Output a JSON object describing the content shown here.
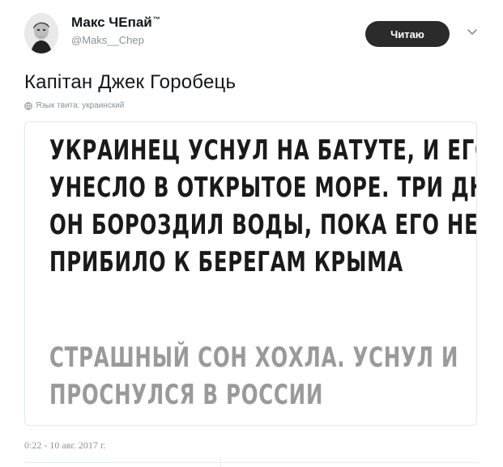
{
  "user": {
    "display_name": "Макс ЧЕпай",
    "name_mark": "™",
    "handle": "@Maks__Chep"
  },
  "follow_button_label": "Читаю",
  "tweet": {
    "text": "Капітан Джек Горобець",
    "language_note": "Язык твита: украинский",
    "timestamp": "0:22 - 10 авг. 2017 г."
  },
  "meme": {
    "main_lines": [
      "УКРАИНЕЦ УСНУЛ НА БАТУТЕ, И ЕГО",
      "УНЕСЛО В ОТКРЫТОЕ МОРЕ. ТРИ ДНЯ",
      "ОН БОРОЗДИЛ ВОДЫ, ПОКА ЕГО НЕ",
      "ПРИБИЛО К БЕРЕГАМ КРЫМА"
    ],
    "sub_lines": [
      "СТРАШНЫЙ СОН ХОХЛА. УСНУЛ И",
      "ПРОСНУЛСЯ В РОССИИ"
    ]
  },
  "icons": {
    "avatar": "avatar-portrait",
    "menu": "chevron-down-icon",
    "language": "globe-icon"
  },
  "colors": {
    "follow_button_bg": "#2b2b2b",
    "meme_main_text": "#1a1a1a",
    "meme_sub_text": "#9a9a9a",
    "muted_text": "#8a9199"
  }
}
